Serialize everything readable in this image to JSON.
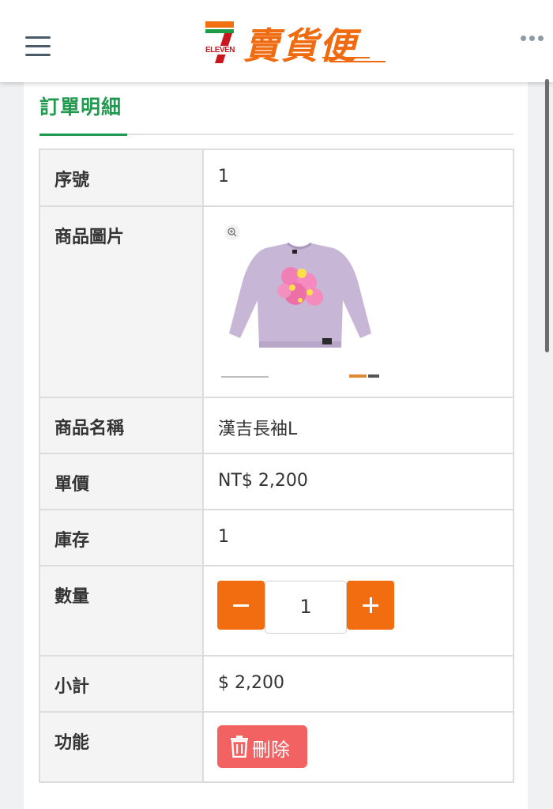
{
  "header": {
    "logo_text": "賣貨便",
    "logo_brand_numeral": "7",
    "logo_brand_word": "ELEVEN",
    "menu_icon": "hamburger-icon",
    "more_icon": "more-horizontal-icon"
  },
  "section": {
    "title": "訂單明細"
  },
  "order_rows": {
    "serial": {
      "label": "序號",
      "value": "1"
    },
    "image": {
      "label": "商品圖片",
      "zoom_icon": "zoom-in-icon"
    },
    "name": {
      "label": "商品名稱",
      "value": "漢吉長袖L"
    },
    "unit_price": {
      "label": "單價",
      "value": "NT$ 2,200"
    },
    "stock": {
      "label": "庫存",
      "value": "1"
    },
    "quantity": {
      "label": "數量",
      "value": "1",
      "decrement_icon": "minus-icon",
      "increment_icon": "plus-icon"
    },
    "subtotal": {
      "label": "小計",
      "value": "$ 2,200"
    },
    "actions": {
      "label": "功能",
      "delete_label": "刪除",
      "delete_icon": "trash-icon"
    }
  },
  "colors": {
    "brand_green": "#1f9a4e",
    "brand_orange": "#f26d10",
    "delete_red": "#f26262",
    "sweatshirt_lavender": "#c7b6d6"
  }
}
